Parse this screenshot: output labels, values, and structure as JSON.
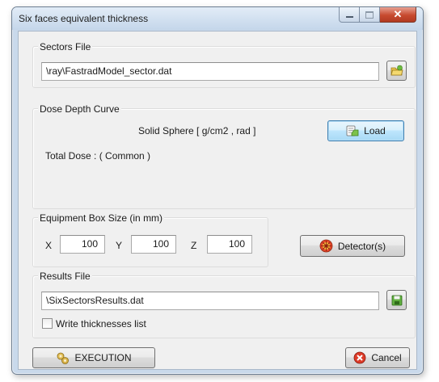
{
  "window": {
    "title": "Six faces equivalent thickness"
  },
  "sectors": {
    "group_label": "Sectors File",
    "file_value": "\\ray\\FastradModel_sector.dat"
  },
  "dose": {
    "group_label": "Dose Depth Curve",
    "curve_label": "Solid Sphere [ g/cm2 , rad ]",
    "load_label": "Load",
    "total_dose_label": "Total Dose : ( Common )"
  },
  "equipment": {
    "group_label": "Equipment Box Size (in mm)",
    "x_label": "X",
    "x_value": "100",
    "y_label": "Y",
    "y_value": "100",
    "z_label": "Z",
    "z_value": "100",
    "detector_label": "Detector(s)"
  },
  "results": {
    "group_label": "Results File",
    "file_value": "\\SixSectorsResults.dat",
    "write_list_label": "Write thicknesses list",
    "write_list_checked": false
  },
  "footer": {
    "execution_label": "EXECUTION",
    "cancel_label": "Cancel"
  },
  "icons": {
    "sectors_browse": "folder-icon",
    "load": "load-icon",
    "detector": "detector-icon",
    "results_browse": "save-icon",
    "execution": "execution-icon",
    "cancel": "cancel-icon"
  },
  "colors": {
    "titlebar": "#c4d6ea",
    "close_button": "#c74a2f",
    "dialog_background": "#f0f0f0",
    "focus_button": "#bee6fd"
  }
}
